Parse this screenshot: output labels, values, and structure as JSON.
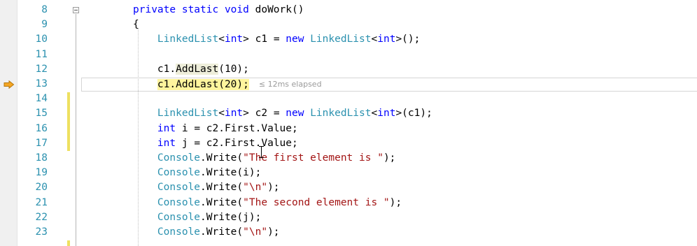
{
  "editor": {
    "lines": [
      {
        "num": "8",
        "parts": [
          {
            "t": "private ",
            "c": "kw"
          },
          {
            "t": "static ",
            "c": "kw"
          },
          {
            "t": "void ",
            "c": "kw"
          },
          {
            "t": "doWork",
            "c": ""
          },
          {
            "t": "()",
            "c": ""
          }
        ]
      },
      {
        "num": "9",
        "parts": [
          {
            "t": "{",
            "c": ""
          }
        ]
      },
      {
        "num": "10",
        "parts": [
          {
            "t": "    ",
            "c": ""
          },
          {
            "t": "LinkedList",
            "c": "ty"
          },
          {
            "t": "<",
            "c": ""
          },
          {
            "t": "int",
            "c": "kw"
          },
          {
            "t": "> c1 = ",
            "c": ""
          },
          {
            "t": "new ",
            "c": "kw"
          },
          {
            "t": "LinkedList",
            "c": "ty"
          },
          {
            "t": "<",
            "c": ""
          },
          {
            "t": "int",
            "c": "kw"
          },
          {
            "t": ">();",
            "c": ""
          }
        ]
      },
      {
        "num": "11",
        "parts": []
      },
      {
        "num": "12",
        "parts": [
          {
            "t": "    ",
            "c": ""
          },
          {
            "t": "c1.",
            "c": ""
          },
          {
            "t": "AddLast",
            "c": "hlsoft"
          },
          {
            "t": "(10);",
            "c": ""
          }
        ]
      },
      {
        "num": "13",
        "parts": [
          {
            "t": "    ",
            "c": ""
          },
          {
            "t": "c1.AddLast(20);",
            "c": "hl"
          }
        ],
        "elapsed": "≤ 12ms elapsed",
        "current": true
      },
      {
        "num": "14",
        "parts": []
      },
      {
        "num": "15",
        "parts": [
          {
            "t": "    ",
            "c": ""
          },
          {
            "t": "LinkedList",
            "c": "ty"
          },
          {
            "t": "<",
            "c": ""
          },
          {
            "t": "int",
            "c": "kw"
          },
          {
            "t": "> c2 = ",
            "c": ""
          },
          {
            "t": "new ",
            "c": "kw"
          },
          {
            "t": "LinkedList",
            "c": "ty"
          },
          {
            "t": "<",
            "c": ""
          },
          {
            "t": "int",
            "c": "kw"
          },
          {
            "t": ">(c1);",
            "c": ""
          }
        ]
      },
      {
        "num": "16",
        "parts": [
          {
            "t": "    ",
            "c": ""
          },
          {
            "t": "int",
            "c": "kw"
          },
          {
            "t": " i = c2.First.Value;",
            "c": ""
          }
        ]
      },
      {
        "num": "17",
        "parts": [
          {
            "t": "    ",
            "c": ""
          },
          {
            "t": "int",
            "c": "kw"
          },
          {
            "t": " j = c2.First.Value;",
            "c": ""
          }
        ]
      },
      {
        "num": "18",
        "parts": [
          {
            "t": "    ",
            "c": ""
          },
          {
            "t": "Console",
            "c": "ty"
          },
          {
            "t": ".Write(",
            "c": ""
          },
          {
            "t": "\"The first element is \"",
            "c": "str"
          },
          {
            "t": ");",
            "c": ""
          }
        ]
      },
      {
        "num": "19",
        "parts": [
          {
            "t": "    ",
            "c": ""
          },
          {
            "t": "Console",
            "c": "ty"
          },
          {
            "t": ".Write(i);",
            "c": ""
          }
        ]
      },
      {
        "num": "20",
        "parts": [
          {
            "t": "    ",
            "c": ""
          },
          {
            "t": "Console",
            "c": "ty"
          },
          {
            "t": ".Write(",
            "c": ""
          },
          {
            "t": "\"\\n\"",
            "c": "str"
          },
          {
            "t": ");",
            "c": ""
          }
        ]
      },
      {
        "num": "21",
        "parts": [
          {
            "t": "    ",
            "c": ""
          },
          {
            "t": "Console",
            "c": "ty"
          },
          {
            "t": ".Write(",
            "c": ""
          },
          {
            "t": "\"The second element is \"",
            "c": "str"
          },
          {
            "t": ");",
            "c": ""
          }
        ]
      },
      {
        "num": "22",
        "parts": [
          {
            "t": "    ",
            "c": ""
          },
          {
            "t": "Console",
            "c": "ty"
          },
          {
            "t": ".Write(j);",
            "c": ""
          }
        ]
      },
      {
        "num": "23",
        "parts": [
          {
            "t": "    ",
            "c": ""
          },
          {
            "t": "Console",
            "c": "ty"
          },
          {
            "t": ".Write(",
            "c": ""
          },
          {
            "t": "\"\\n\"",
            "c": "str"
          },
          {
            "t": ");",
            "c": ""
          }
        ]
      }
    ],
    "colors": {
      "keyword": "#0000ff",
      "type": "#2b91af",
      "string": "#a31515",
      "line_number": "#2b91af",
      "current_highlight": "#fff59d",
      "change_bar": "#eee060",
      "arrow": "#f5a623"
    },
    "icons": {
      "current_statement": "instruction-pointer-arrow-icon",
      "fold": "collapse-minus-icon"
    }
  }
}
